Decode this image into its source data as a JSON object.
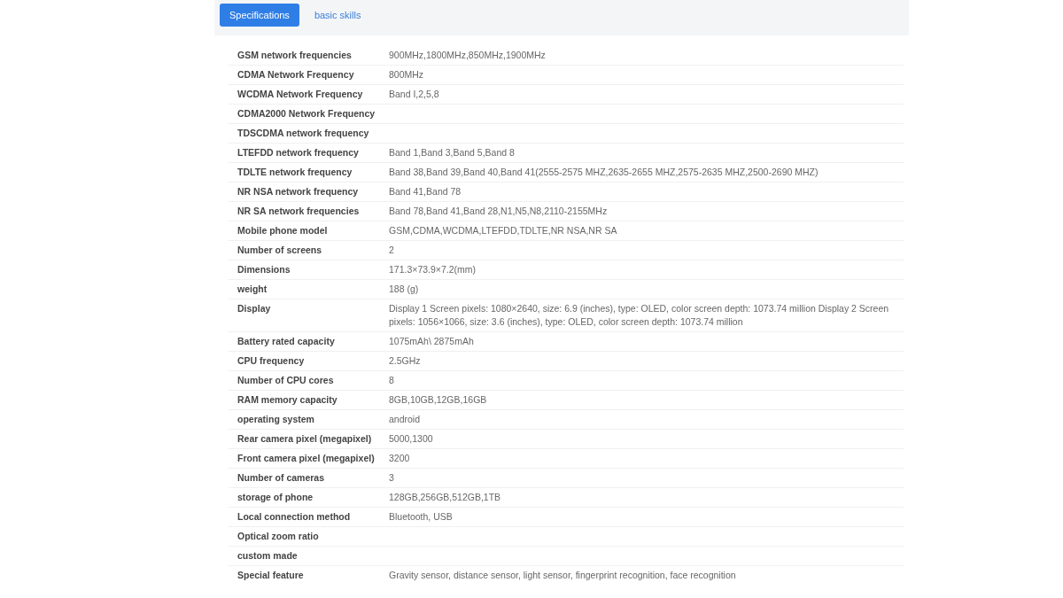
{
  "tabs": [
    {
      "label": "Specifications",
      "selected": true
    },
    {
      "label": "basic skills",
      "selected": false
    }
  ],
  "specs": [
    {
      "label": "GSM network frequencies",
      "value": "900MHz,1800MHz,850MHz,1900MHz"
    },
    {
      "label": "CDMA Network Frequency",
      "value": "800MHz"
    },
    {
      "label": "WCDMA Network Frequency",
      "value": "Band I,2,5,8"
    },
    {
      "label": "CDMA2000 Network Frequency"
    },
    {
      "label": "TDSCDMA network frequency"
    },
    {
      "label": "LTEFDD network frequency",
      "value": "Band 1,Band 3,Band 5,Band 8"
    },
    {
      "label": "TDLTE network frequency",
      "value": "Band 38,Band 39,Band 40,Band 41(2555-2575 MHZ,2635-2655 MHZ,2575-2635 MHZ,2500-2690 MHZ)"
    },
    {
      "label": "NR NSA network frequency",
      "value": "Band 41,Band 78"
    },
    {
      "label": "NR SA network frequencies",
      "value": "Band 78,Band 41,Band 28,N1,N5,N8,2110-2155MHz"
    },
    {
      "label": "Mobile phone model",
      "value": "GSM,CDMA,WCDMA,LTEFDD,TDLTE,NR NSA,NR SA"
    },
    {
      "label": "Number of screens",
      "value": "2"
    },
    {
      "label": "Dimensions",
      "value": "171.3×73.9×7.2(mm)"
    },
    {
      "label": "weight",
      "value": "188 (g)"
    },
    {
      "label": "Display",
      "value": "Display 1 Screen pixels: 1080×2640, size: 6.9 (inches), type: OLED, color screen depth: 1073.74 million Display 2 Screen pixels: 1056×1066, size: 3.6 (inches), type: OLED, color screen depth: 1073.74 million"
    },
    {
      "label": "Battery rated capacity",
      "value": "1075mAh\\ 2875mAh"
    },
    {
      "label": "CPU frequency",
      "value": "2.5GHz"
    },
    {
      "label": "Number of CPU cores",
      "value": "8"
    },
    {
      "label": "RAM memory capacity",
      "value": "8GB,10GB,12GB,16GB"
    },
    {
      "label": "operating system",
      "value": "android"
    },
    {
      "label": "Rear camera pixel (megapixel)",
      "value": "5000,1300"
    },
    {
      "label": "Front camera pixel (megapixel)",
      "value": "3200"
    },
    {
      "label": "Number of cameras",
      "value": "3"
    },
    {
      "label": "storage of phone",
      "value": "128GB,256GB,512GB,1TB"
    },
    {
      "label": "Local connection method",
      "value": "Bluetooth, USB"
    },
    {
      "label": "Optical zoom ratio"
    },
    {
      "label": "custom made"
    },
    {
      "label": "Special feature",
      "value": "Gravity sensor, distance sensor, light sensor, fingerprint recognition, face recognition"
    }
  ]
}
